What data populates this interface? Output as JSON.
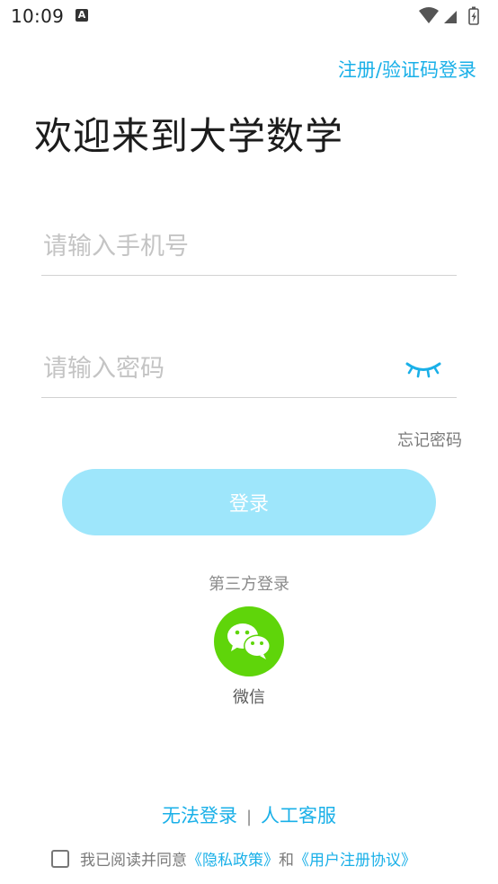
{
  "status_bar": {
    "time": "10:09",
    "notification_icon_letter": "A"
  },
  "header": {
    "register_link": "注册/验证码登录"
  },
  "welcome": {
    "title": "欢迎来到大学数学"
  },
  "form": {
    "phone_placeholder": "请输入手机号",
    "phone_value": "",
    "password_placeholder": "请输入密码",
    "password_value": "",
    "forgot_password": "忘记密码",
    "login_button": "登录"
  },
  "third_party": {
    "label": "第三方登录",
    "wechat_label": "微信"
  },
  "help": {
    "cannot_login": "无法登录",
    "separator": "|",
    "customer_service": "人工客服"
  },
  "agreement": {
    "prefix": "我已阅读并同意",
    "privacy_policy": "《隐私政策》",
    "and": "和",
    "user_agreement": "《用户注册协议》"
  },
  "colors": {
    "accent": "#1ab0e8",
    "login_button_bg": "#9ee6fb",
    "wechat_green": "#5fd50a"
  },
  "icons": {
    "eye": "closed-eye-icon",
    "wechat": "wechat-icon",
    "wifi": "wifi-icon",
    "signal": "signal-icon",
    "battery": "battery-icon"
  }
}
